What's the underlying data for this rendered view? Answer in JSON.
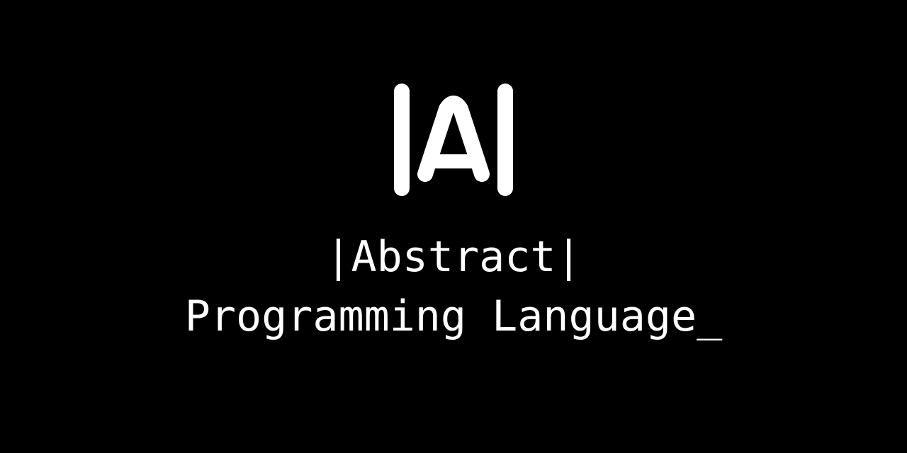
{
  "colors": {
    "background": "#000000",
    "foreground": "#ffffff"
  },
  "logo": {
    "icon": "abstract-a-logo-icon"
  },
  "title": {
    "line1": "|Abstract|",
    "line2": "Programming Language_"
  }
}
